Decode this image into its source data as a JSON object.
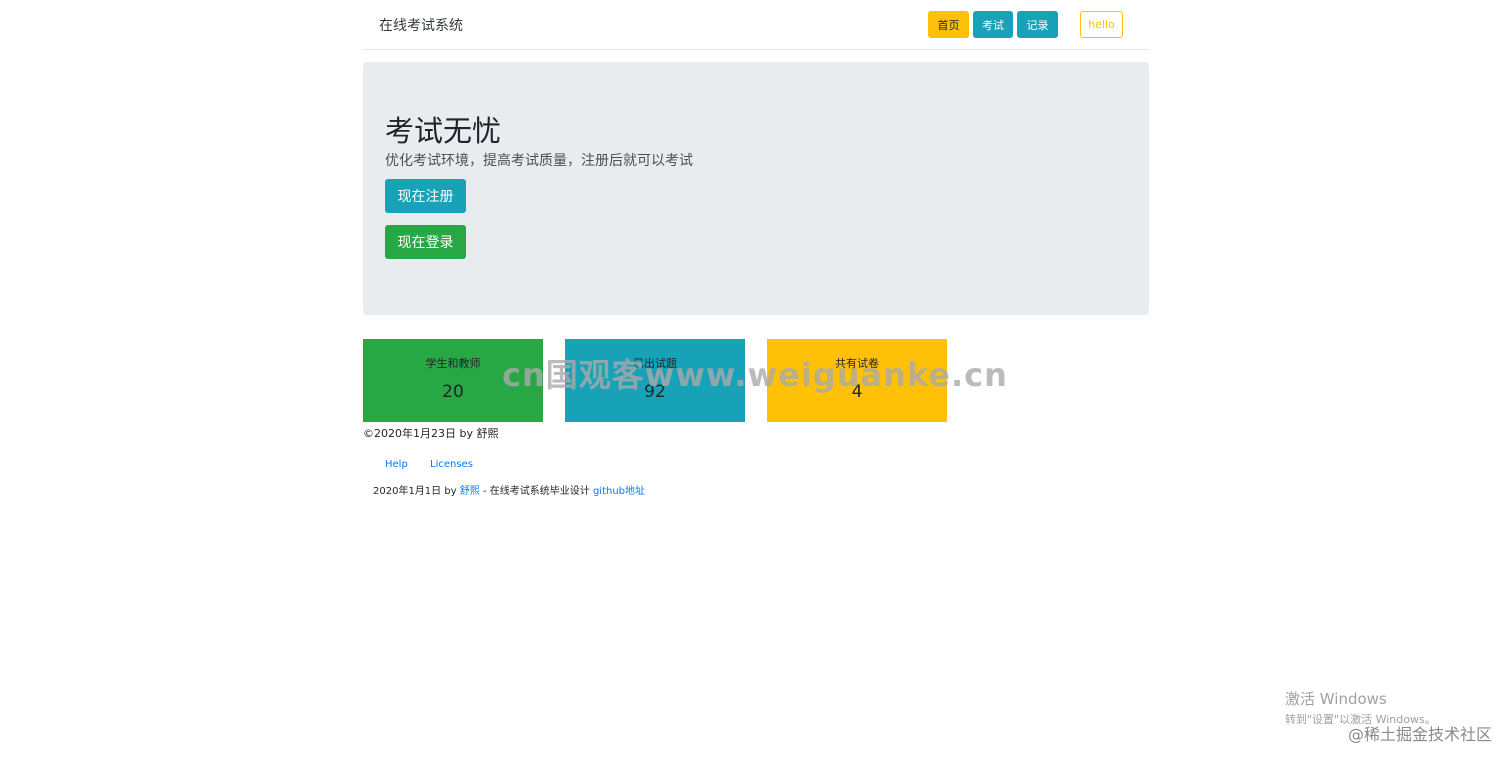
{
  "navbar": {
    "brand": "在线考试系统",
    "home_label": "首页",
    "exam_label": "考试",
    "record_label": "记录",
    "user_label": "hello"
  },
  "jumbotron": {
    "title": "考试无忧",
    "subtitle": "优化考试环境，提高考试质量，注册后就可以考试",
    "register_label": "现在注册",
    "login_label": "现在登录"
  },
  "stats": [
    {
      "label": "学生和教师",
      "value": "20"
    },
    {
      "label": "已出试题",
      "value": "92"
    },
    {
      "label": "共有试卷",
      "value": "4"
    }
  ],
  "copyright": "©2020年1月23日 by 舒熙",
  "footer": {
    "links": [
      "Help",
      "Licenses"
    ],
    "date_text": "2020年1月1日 by ",
    "author_link": "舒熙",
    "middle_text": " - 在线考试系统毕业设计 ",
    "github_link": "github地址"
  },
  "watermarks": {
    "center": "cn国观客www.weiguanke.cn",
    "windows_title": "激活 Windows",
    "windows_sub": "转到\"设置\"以激活 Windows。",
    "juejin": "@稀土掘金技术社区"
  },
  "colors": {
    "primary_yellow": "#ffc107",
    "info_teal": "#17a2b8",
    "success_green": "#28a745",
    "jumbotron_bg": "#e9ecef",
    "link_blue": "#007bff"
  }
}
